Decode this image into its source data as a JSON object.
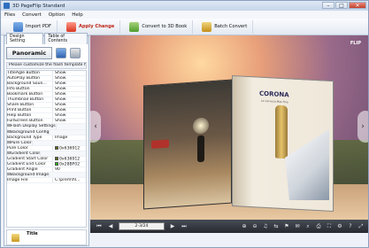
{
  "window": {
    "title": "3D PageFlip Standard",
    "controls": [
      "–",
      "□",
      "✕"
    ]
  },
  "menu": [
    "Files",
    "Convert",
    "Option",
    "Help"
  ],
  "toolbar": {
    "import": "Import PDF",
    "apply": "Apply Change",
    "convert": "Convert to 3D Book",
    "batch": "Batch Convert"
  },
  "tabs": [
    "Design Setting",
    "Table of Contents"
  ],
  "template": {
    "button": "Panoramic",
    "hint": "Please customize the flash template here"
  },
  "properties": [
    {
      "k": "TitleAgle Button",
      "v": "Show"
    },
    {
      "k": "AutoPlay Button",
      "v": "Show"
    },
    {
      "k": "Background Soun...",
      "v": "Show"
    },
    {
      "k": "Info Button",
      "v": "Show"
    },
    {
      "k": "Bookmark Button",
      "v": "Show"
    },
    {
      "k": "Thumbnail Button",
      "v": "Show"
    },
    {
      "k": "Share Button",
      "v": "Show"
    },
    {
      "k": "Print Button",
      "v": "Show"
    },
    {
      "k": "Help Button",
      "v": "Show"
    },
    {
      "k": "FullScreen Button",
      "v": "Show"
    },
    {
      "k": "⊟Flash Display Settings",
      "v": "",
      "grp": true
    },
    {
      "k": " ⊟Background Config",
      "v": "",
      "grp": true
    },
    {
      "k": "   Background Type",
      "v": "Image"
    },
    {
      "k": "  ⊟Pure Color",
      "v": "",
      "grp": true
    },
    {
      "k": "    Pure Color",
      "v": "0x636912",
      "sw": "#636912"
    },
    {
      "k": "  ⊟Gradient Color",
      "v": "",
      "grp": true
    },
    {
      "k": "    Gradient Start Color",
      "v": "0x636912",
      "sw": "#636912"
    },
    {
      "k": "    Gradient End Color",
      "v": "0x28BF02",
      "sw": "#28bf02"
    },
    {
      "k": "    Gradient Angle",
      "v": "90"
    },
    {
      "k": "  ⊟Background Image",
      "v": "",
      "grp": true
    },
    {
      "k": "    Image File",
      "v": "C:\\prem\\fil..."
    }
  ],
  "description": {
    "title": "Title"
  },
  "preview": {
    "page": "2-3/24",
    "logo": "FLIP",
    "book": {
      "brand": "CORONA",
      "tagline": "La Cerveza Mas Fina"
    }
  },
  "player_icons": {
    "left": [
      "⏮",
      "◀",
      "▶",
      "⏭"
    ],
    "right": [
      "⊕",
      "⊖",
      "♫",
      "⇆",
      "⚑",
      "✉",
      "⌕",
      "⎙",
      "⛶",
      "⚙",
      "?",
      "⤢"
    ]
  }
}
